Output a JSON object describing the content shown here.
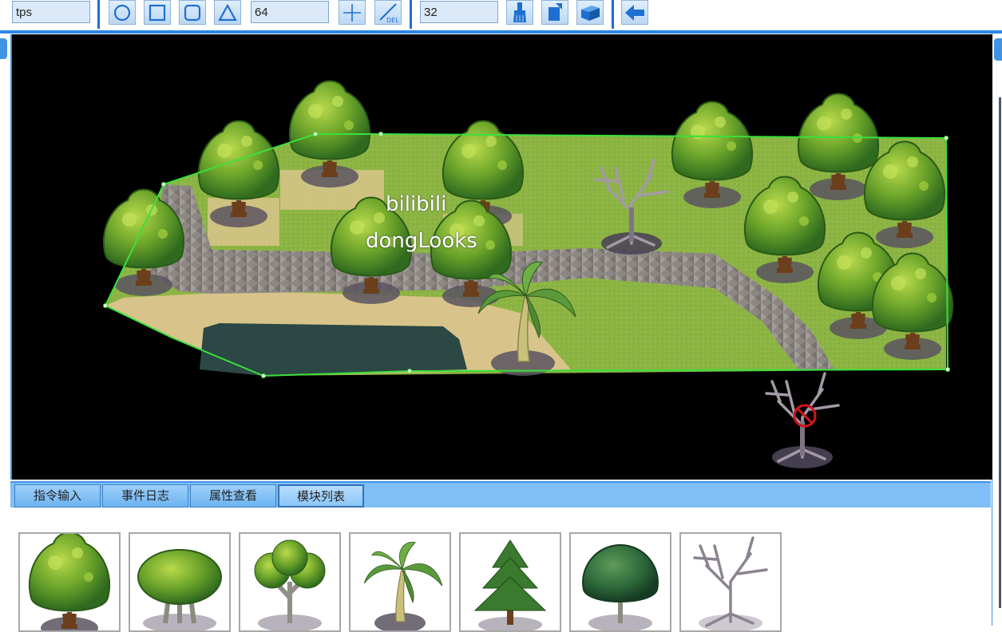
{
  "toolbar": {
    "name_value": "tps",
    "size_value": "64",
    "grid_value": "32",
    "tools": [
      {
        "name": "circle-icon"
      },
      {
        "name": "square-icon"
      },
      {
        "name": "rounded-square-icon"
      },
      {
        "name": "triangle-icon"
      },
      {
        "name": "crosshair-icon"
      },
      {
        "name": "delete-line-icon",
        "label": "DEL"
      },
      {
        "name": "brush-icon"
      },
      {
        "name": "rotate-icon"
      },
      {
        "name": "cube-icon"
      },
      {
        "name": "back-arrow-icon"
      }
    ]
  },
  "canvas": {
    "watermark_line1": "bilibili",
    "watermark_line2": "dongLooks"
  },
  "tabs": [
    {
      "label": "指令输入",
      "active": false
    },
    {
      "label": "事件日志",
      "active": false
    },
    {
      "label": "属性查看",
      "active": false
    },
    {
      "label": "模块列表",
      "active": true
    }
  ],
  "assets": [
    {
      "name": "round-tree-icon"
    },
    {
      "name": "wide-tree-icon"
    },
    {
      "name": "branchy-tree-icon"
    },
    {
      "name": "palm-tree-icon"
    },
    {
      "name": "pine-tree-icon"
    },
    {
      "name": "dark-tree-icon"
    },
    {
      "name": "dead-tree-icon"
    }
  ],
  "colors": {
    "accent": "#2a86e6",
    "selection": "#3be03b",
    "grass": "#8db644",
    "path": "#8e8a86",
    "water": "#2f4a45",
    "sand": "#d9c48a"
  }
}
